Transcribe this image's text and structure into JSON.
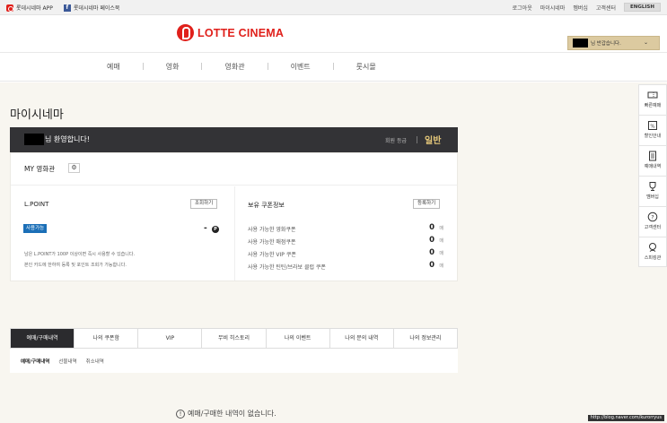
{
  "topbar": {
    "app_label": "롯데시네마 APP",
    "facebook_label": "롯데시네마 페이스북",
    "links": [
      "로그아웃",
      "마이시네마",
      "멤버십",
      "고객센터"
    ],
    "english": "ENGLISH"
  },
  "header": {
    "logo_text": "LOTTE CINEMA",
    "welcome_text": "님 반갑습니다.",
    "dropdown_icon": "chevron-down-icon"
  },
  "nav": {
    "items": [
      "예매",
      "영화",
      "영화관",
      "이벤트",
      "룻시몰"
    ]
  },
  "page": {
    "title": "마이시네마"
  },
  "welcome": {
    "greeting": "님 환영합니다!",
    "grade_label": "회원 등급",
    "grade_value": "일반"
  },
  "mycinema": {
    "label": "MY 영화관",
    "settings_icon": "gear-icon"
  },
  "lpoint": {
    "title": "L.POINT",
    "lookup_button": "조회하기",
    "badge": "사용가능",
    "points": "-",
    "point_icon_letter": "P",
    "note1": "남은 L.POINT가 100P 이상이면 즉시 사용할 수 있습니다.",
    "note2": "본인 카드에 한하여 등록 및 포인트 조회가 가능합니다."
  },
  "coupons": {
    "title": "보유 쿠폰정보",
    "register_button": "등록하기",
    "rows": [
      {
        "label": "사용 가능한 영화쿠폰",
        "count": "0",
        "unit": "매"
      },
      {
        "label": "사용 가능한 매점쿠폰",
        "count": "0",
        "unit": "매"
      },
      {
        "label": "사용 가능한 VIP 쿠폰",
        "count": "0",
        "unit": "매"
      },
      {
        "label": "사용 가능한 틴틴/브라보 클럽 쿠폰",
        "count": "0",
        "unit": "매"
      }
    ]
  },
  "tabs": [
    "예매/구매내역",
    "나의 쿠폰함",
    "VIP",
    "무비 히스토리",
    "나의 이벤트",
    "나의 문의 내역",
    "나의 정보관리"
  ],
  "subtabs": [
    "예매/구매내역",
    "선물내역",
    "취소내역"
  ],
  "empty_message": "예매/구매한 내역이 없습니다.",
  "quick_menu": [
    {
      "label": "빠른예매",
      "icon": "ticket-icon"
    },
    {
      "label": "할인안내",
      "icon": "discount-icon"
    },
    {
      "label": "예매내역",
      "icon": "receipt-icon"
    },
    {
      "label": "멤버십",
      "icon": "trophy-icon"
    },
    {
      "label": "고객센터",
      "icon": "help-icon"
    },
    {
      "label": "스피킹관",
      "icon": "speaker-icon"
    }
  ],
  "watermark": "http://blog.naver.com/kurorryus"
}
